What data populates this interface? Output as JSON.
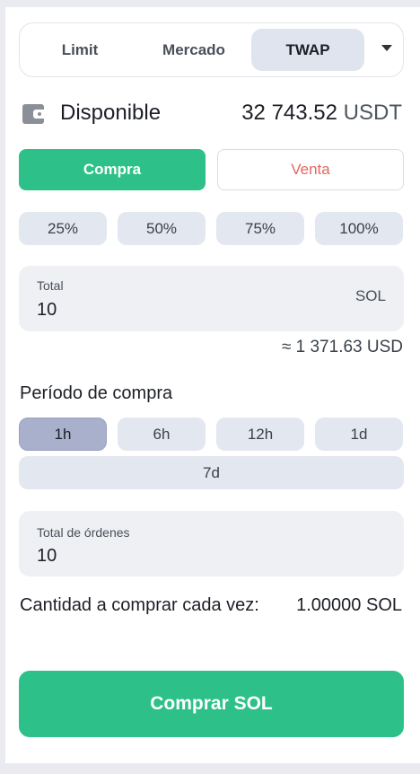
{
  "order_tabs": [
    "Limit",
    "Mercado",
    "TWAP"
  ],
  "active_tab": "TWAP",
  "balance": {
    "label": "Disponible",
    "amount": "32 743.52",
    "currency": "USDT"
  },
  "side": {
    "buy_label": "Compra",
    "sell_label": "Venta",
    "selected": "Compra"
  },
  "percent_chips": [
    "25%",
    "50%",
    "75%",
    "100%"
  ],
  "total": {
    "label": "Total",
    "value": "10",
    "unit": "SOL",
    "approx": "≈ 1 371.63 USD"
  },
  "period": {
    "title": "Período de compra",
    "options": [
      "1h",
      "6h",
      "12h",
      "1d",
      "7d"
    ],
    "selected": "1h"
  },
  "orders": {
    "label": "Total de órdenes",
    "value": "10"
  },
  "per_order": {
    "label": "Cantidad a comprar cada vez:",
    "value": "1.00000 SOL"
  },
  "submit_label": "Comprar SOL",
  "colors": {
    "buy": "#2dc189",
    "sell_text": "#e06861",
    "chip_bg": "#e3e7ef",
    "chip_selected": "#a9b0cb"
  },
  "icons": {
    "wallet": "wallet-icon",
    "dropdown": "chevron-down-icon"
  }
}
